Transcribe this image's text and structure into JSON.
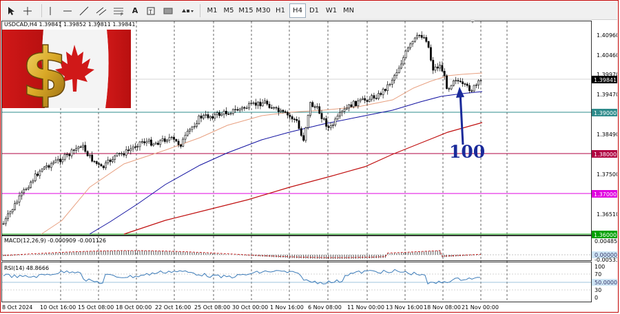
{
  "toolbar": {
    "tools": [
      "cursor-icon",
      "crosshair-icon",
      "vertical-line-icon",
      "horizontal-line-icon",
      "trendline-icon",
      "channel-icon",
      "fibonacci-icon",
      "text-icon",
      "label-icon",
      "rectangle-icon",
      "shapes-icon"
    ],
    "timeframes": [
      "M1",
      "M5",
      "M15",
      "M30",
      "H1",
      "H4",
      "D1",
      "W1",
      "MN"
    ],
    "active_timeframe": "H4"
  },
  "symbol_info": "USDCAD,H4  1.39841 1.39852 1.39811 1.39841",
  "annotation": "100",
  "price_axis": {
    "labels": [
      "1.40960",
      "1.40460",
      "1.39970",
      "1.39470",
      "1.38490",
      "1.37500",
      "1.36510"
    ],
    "current_price": "1.39841",
    "levels": [
      {
        "label": "1.39000",
        "color": "#2e8b8b"
      },
      {
        "label": "1.38000",
        "color": "#b00040"
      },
      {
        "label": "1.37000",
        "color": "#e000e0"
      },
      {
        "label": "1.36000",
        "color": "#00a000"
      }
    ]
  },
  "time_axis": [
    "8 Oct 2024",
    "10 Oct 16:00",
    "15 Oct 08:00",
    "18 Oct 00:00",
    "22 Oct 16:00",
    "25 Oct 08:00",
    "30 Oct 00:00",
    "1 Nov 16:00",
    "6 Nov 08:00",
    "11 Nov 00:00",
    "13 Nov 16:00",
    "18 Nov 08:00",
    "21 Nov 00:00"
  ],
  "macd": {
    "label": "MACD(12,26,9) -0.000909 -0.001126",
    "axis": [
      "0.004852",
      "0.000000",
      "-0.005335"
    ]
  },
  "rsi": {
    "label": "RSI(14) 48.8666",
    "axis": [
      "100",
      "70",
      "50.0000",
      "30",
      "0"
    ]
  },
  "colors": {
    "candles": "#000000",
    "ma_orange": "#e8a080",
    "ma_blue": "#1010a0",
    "ma_red": "#c01010",
    "annotation": "#1a2a9a",
    "rsi_line": "#3a7ab8"
  }
}
